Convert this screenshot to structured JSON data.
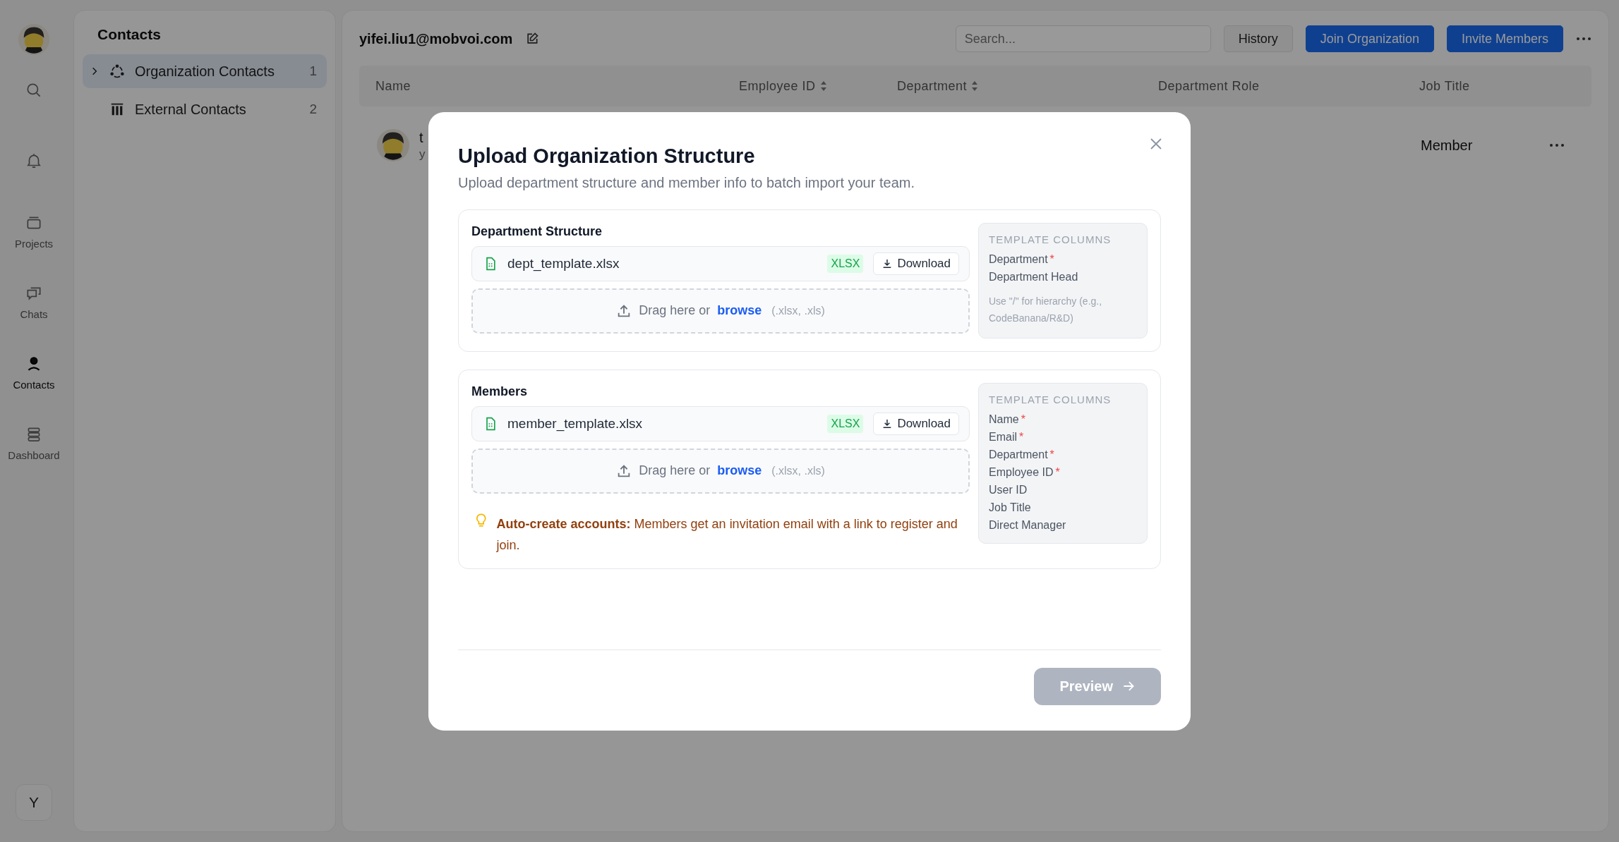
{
  "rail": {
    "items": [
      {
        "kind": "search",
        "selected": false
      },
      {
        "kind": "bell",
        "selected": false
      },
      {
        "kind": "projects",
        "label": "Projects",
        "selected": false
      },
      {
        "kind": "chats",
        "label": "Chats",
        "selected": false
      },
      {
        "kind": "contacts",
        "label": "Contacts",
        "selected": true
      },
      {
        "kind": "dashboard",
        "label": "Dashboard",
        "selected": false
      }
    ],
    "user_initial": "Y"
  },
  "contacts_panel": {
    "title": "Contacts",
    "items": [
      {
        "kind": "org",
        "label": "Organization Contacts",
        "count": "1",
        "selected": true,
        "expandable": true
      },
      {
        "kind": "external",
        "label": "External Contacts",
        "count": "2",
        "selected": false,
        "expandable": false
      }
    ]
  },
  "header": {
    "email": "yifei.liu1@mobvoi.com",
    "search_placeholder": "Search...",
    "buttons": [
      {
        "label": "History",
        "primary": false
      },
      {
        "label": "Join Organization",
        "primary": true
      },
      {
        "label": "Invite Members",
        "primary": true
      }
    ]
  },
  "table": {
    "columns": [
      {
        "label": "Name",
        "sortable": false
      },
      {
        "label": "Employee ID",
        "sortable": true
      },
      {
        "label": "Department",
        "sortable": true
      },
      {
        "label": "Department Role",
        "sortable": false
      },
      {
        "label": "Job Title",
        "sortable": false
      }
    ],
    "rows": [
      {
        "name": "t",
        "sub": "y",
        "job_title": "Member"
      }
    ]
  },
  "modal": {
    "title": "Upload Organization Structure",
    "subtitle": "Upload department structure and member info to batch import your team.",
    "sections": [
      {
        "title": "Department Structure",
        "file": {
          "name": "dept_template.xlsx",
          "badge": "XLSX",
          "download": "Download"
        },
        "dropzone": {
          "text": "Drag here or",
          "link": "browse",
          "hint": "(.xlsx, .xls)"
        },
        "template": {
          "heading": "TEMPLATE COLUMNS",
          "columns": [
            {
              "name": "Department",
              "mark": "*"
            },
            {
              "name": "Department Head"
            }
          ],
          "note": "Use \"/\" for hierarchy (e.g., CodeBanana/R&D)"
        }
      },
      {
        "title": "Members",
        "file": {
          "name": "member_template.xlsx",
          "badge": "XLSX",
          "download": "Download"
        },
        "dropzone": {
          "text": "Drag here or",
          "link": "browse",
          "hint": "(.xlsx, .xls)"
        },
        "tip": "**Auto-create accounts:** Members get an invitation email with a link to register and join.",
        "template": {
          "heading": "TEMPLATE COLUMNS",
          "columns": [
            {
              "name": "Name",
              "mark": "*"
            },
            {
              "name": "Email",
              "mark": "*"
            },
            {
              "name": "Department",
              "mark": "*"
            },
            {
              "name": "Employee ID",
              "mark": "*"
            },
            {
              "name": "User ID"
            },
            {
              "name": "Job Title"
            },
            {
              "name": "Direct Manager"
            }
          ]
        }
      }
    ],
    "preview_button": {
      "label": "Preview",
      "disabled": true
    }
  }
}
